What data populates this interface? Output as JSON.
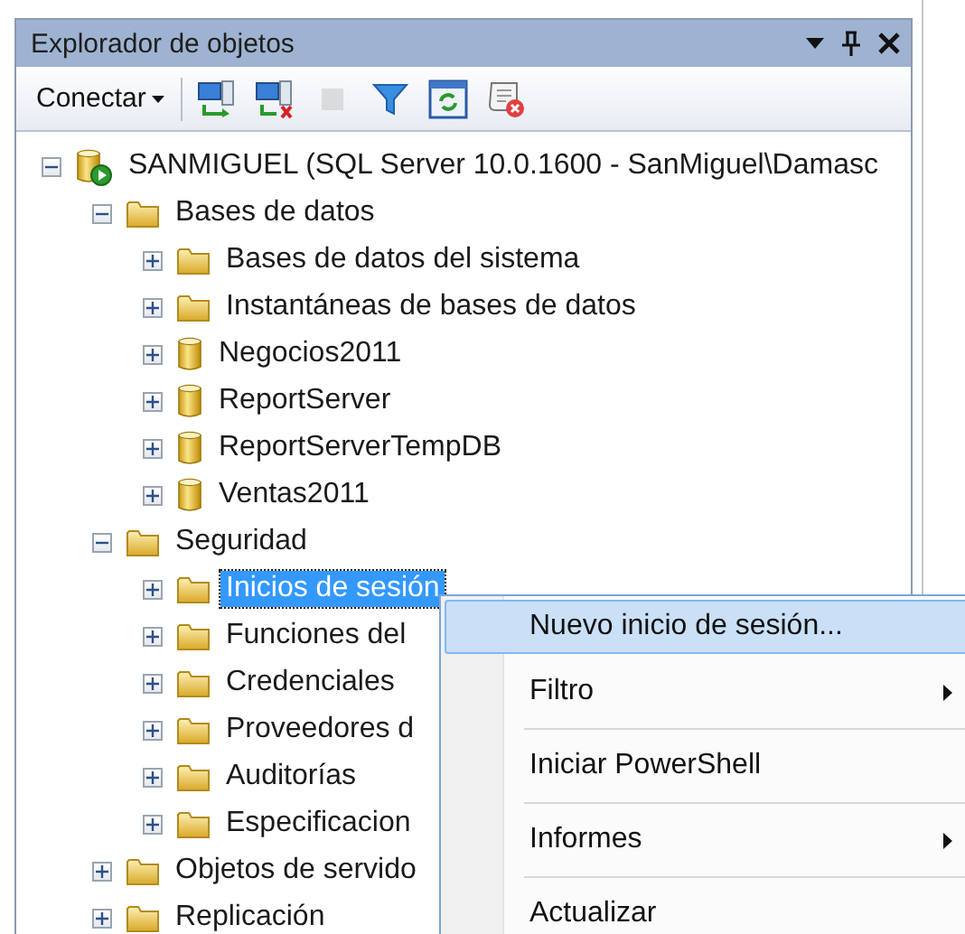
{
  "panel": {
    "title": "Explorador de objetos"
  },
  "toolbar": {
    "connect_label": "Conectar",
    "buttons": [
      {
        "kind": "connect",
        "disabled": false
      },
      {
        "kind": "disconnect",
        "disabled": false
      },
      {
        "kind": "stop",
        "disabled": true
      },
      {
        "kind": "filter",
        "disabled": false
      },
      {
        "kind": "refresh",
        "disabled": false
      },
      {
        "kind": "script-cancel",
        "disabled": false
      }
    ]
  },
  "tree": [
    {
      "label": "SANMIGUEL (SQL Server 10.0.1600 - SanMiguel\\Damasc",
      "kind": "server",
      "expanded": true,
      "selected": false,
      "children": [
        {
          "label": "Bases de datos",
          "kind": "folder",
          "expanded": true,
          "selected": false,
          "children": [
            {
              "label": "Bases de datos del sistema",
              "kind": "folder",
              "expanded": false,
              "selected": false
            },
            {
              "label": "Instantáneas de bases de datos",
              "kind": "folder",
              "expanded": false,
              "selected": false
            },
            {
              "label": "Negocios2011",
              "kind": "database",
              "expanded": false,
              "selected": false
            },
            {
              "label": "ReportServer",
              "kind": "database",
              "expanded": false,
              "selected": false
            },
            {
              "label": "ReportServerTempDB",
              "kind": "database",
              "expanded": false,
              "selected": false
            },
            {
              "label": "Ventas2011",
              "kind": "database",
              "expanded": false,
              "selected": false
            }
          ]
        },
        {
          "label": "Seguridad",
          "kind": "folder",
          "expanded": true,
          "selected": false,
          "children": [
            {
              "label": "Inicios de sesión",
              "kind": "folder",
              "expanded": false,
              "selected": true
            },
            {
              "label": "Funciones del",
              "kind": "folder",
              "expanded": false,
              "selected": false
            },
            {
              "label": "Credenciales",
              "kind": "folder",
              "expanded": false,
              "selected": false
            },
            {
              "label": "Proveedores d",
              "kind": "folder",
              "expanded": false,
              "selected": false
            },
            {
              "label": "Auditorías",
              "kind": "folder",
              "expanded": false,
              "selected": false
            },
            {
              "label": "Especificacion",
              "kind": "folder",
              "expanded": false,
              "selected": false
            }
          ]
        },
        {
          "label": "Objetos de servido",
          "kind": "folder",
          "expanded": false,
          "selected": false
        },
        {
          "label": "Replicación",
          "kind": "folder",
          "expanded": false,
          "selected": false
        }
      ]
    }
  ],
  "context_menu": [
    {
      "kind": "item",
      "label": "Nuevo inicio de sesión...",
      "selected": true,
      "submenu": false
    },
    {
      "kind": "item",
      "label": "Filtro",
      "selected": false,
      "submenu": true
    },
    {
      "kind": "separator"
    },
    {
      "kind": "item",
      "label": "Iniciar PowerShell",
      "selected": false,
      "submenu": false
    },
    {
      "kind": "separator"
    },
    {
      "kind": "item",
      "label": "Informes",
      "selected": false,
      "submenu": true
    },
    {
      "kind": "separator"
    },
    {
      "kind": "item",
      "label": "Actualizar",
      "selected": false,
      "submenu": false
    }
  ]
}
